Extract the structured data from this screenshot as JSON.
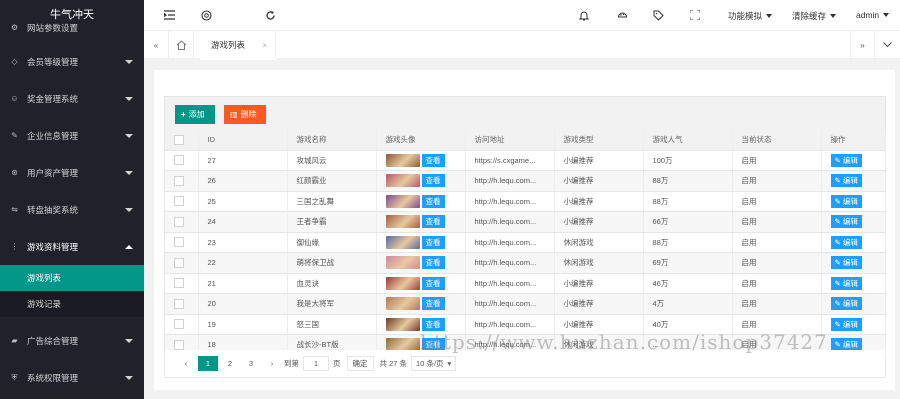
{
  "app": {
    "title": "牛气冲天"
  },
  "sidebar": {
    "items": [
      {
        "label": "网站参数设置",
        "icon": "settings-icon"
      },
      {
        "label": "会员等级管理",
        "icon": "diamond-icon"
      },
      {
        "label": "奖金管理系统",
        "icon": "smile-icon"
      },
      {
        "label": "企业信息管理",
        "icon": "edit-icon"
      },
      {
        "label": "用户资产管理",
        "icon": "asset-icon"
      },
      {
        "label": "转盘抽奖系统",
        "icon": "wheel-icon"
      },
      {
        "label": "游戏资料管理",
        "icon": "more-icon"
      },
      {
        "label": "广告综合管理",
        "icon": "folder-icon"
      },
      {
        "label": "系统权限管理",
        "icon": "shield-icon"
      }
    ],
    "submenu": [
      {
        "label": "游戏列表",
        "active": true
      },
      {
        "label": "游戏记录",
        "active": false
      }
    ]
  },
  "header": {
    "menus": [
      {
        "label": "功能模拟"
      },
      {
        "label": "清除缓存"
      },
      {
        "label": "admin"
      }
    ]
  },
  "tabs": {
    "active_label": "游戏列表",
    "close": "×"
  },
  "toolbar": {
    "add_label": "添加",
    "delete_label": "删除"
  },
  "table": {
    "columns": [
      "ID",
      "游戏名称",
      "游戏头像",
      "访问地址",
      "游戏类型",
      "游戏人气",
      "当前状态",
      "操作"
    ],
    "view_label": "查看",
    "edit_label": "编辑",
    "rows": [
      {
        "id": "27",
        "name": "攻城风云",
        "url": "https://s.cxgame...",
        "type": "小编推荐",
        "pop": "100万",
        "status": "启用",
        "thumb": "#8a5a3a"
      },
      {
        "id": "26",
        "name": "红颜霸业",
        "url": "http://h.lequ.com...",
        "type": "小编推荐",
        "pop": "88万",
        "status": "启用",
        "thumb": "#b05a6a"
      },
      {
        "id": "25",
        "name": "三国之乱舞",
        "url": "http://h.lequ.com...",
        "type": "小编推荐",
        "pop": "88万",
        "status": "启用",
        "thumb": "#7a4a8a"
      },
      {
        "id": "24",
        "name": "王者争霸",
        "url": "http://h.lequ.com...",
        "type": "小编推荐",
        "pop": "66万",
        "status": "启用",
        "thumb": "#a06040"
      },
      {
        "id": "23",
        "name": "御仙缘",
        "url": "http://h.lequ.com...",
        "type": "休闲游戏",
        "pop": "88万",
        "status": "启用",
        "thumb": "#5a6aa0"
      },
      {
        "id": "22",
        "name": "萌将保卫战",
        "url": "http://h.lequ.com...",
        "type": "休闲游戏",
        "pop": "69万",
        "status": "启用",
        "thumb": "#d08aa0"
      },
      {
        "id": "21",
        "name": "血灵诀",
        "url": "http://h.lequ.com...",
        "type": "小编推荐",
        "pop": "46万",
        "status": "启用",
        "thumb": "#9a3a3a"
      },
      {
        "id": "20",
        "name": "我是大将军",
        "url": "http://h.lequ.com...",
        "type": "小编推荐",
        "pop": "4万",
        "status": "启用",
        "thumb": "#b07a5a"
      },
      {
        "id": "19",
        "name": "怒三国",
        "url": "http://h.lequ.com...",
        "type": "小编推荐",
        "pop": "40万",
        "status": "启用",
        "thumb": "#6a3a2a"
      },
      {
        "id": "18",
        "name": "战长沙-BT版",
        "url": "http://h.lequ.com...",
        "type": "休闲游戏",
        "pop": "...",
        "status": "启用",
        "thumb": "#8a6a3a"
      }
    ]
  },
  "pager": {
    "pages": [
      "1",
      "2",
      "3"
    ],
    "goto_prefix": "到第",
    "goto_value": "1",
    "goto_suffix": "页",
    "confirm": "确定",
    "total": "共 27 条",
    "per_page": "10 条/页"
  },
  "watermark": "https://www.huzhan.com/ishop37427"
}
